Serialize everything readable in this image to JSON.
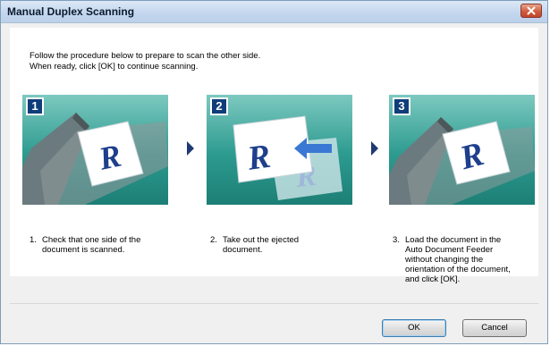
{
  "window": {
    "title": "Manual Duplex Scanning"
  },
  "instructions": {
    "line1": "Follow the procedure below to prepare to scan the other side.",
    "line2": "When ready, click [OK] to continue scanning."
  },
  "steps": [
    {
      "badge": "1",
      "num": "1.",
      "lines": [
        "Check that one side of the",
        "document is scanned."
      ]
    },
    {
      "badge": "2",
      "num": "2.",
      "lines": [
        "Take out the ejected",
        "document."
      ]
    },
    {
      "badge": "3",
      "num": "3.",
      "lines": [
        "Load the document in the",
        "Auto Document Feeder",
        "without changing the",
        "orientation of the document,",
        "and click [OK]."
      ]
    }
  ],
  "buttons": {
    "ok": "OK",
    "cancel": "Cancel"
  },
  "colors": {
    "accent": "#1f3a73",
    "badge": "#0f3d7a",
    "illustration_bg": "#2c9a8f"
  },
  "icons": {
    "close": "close-icon",
    "arrow": "arrow-right-icon"
  }
}
